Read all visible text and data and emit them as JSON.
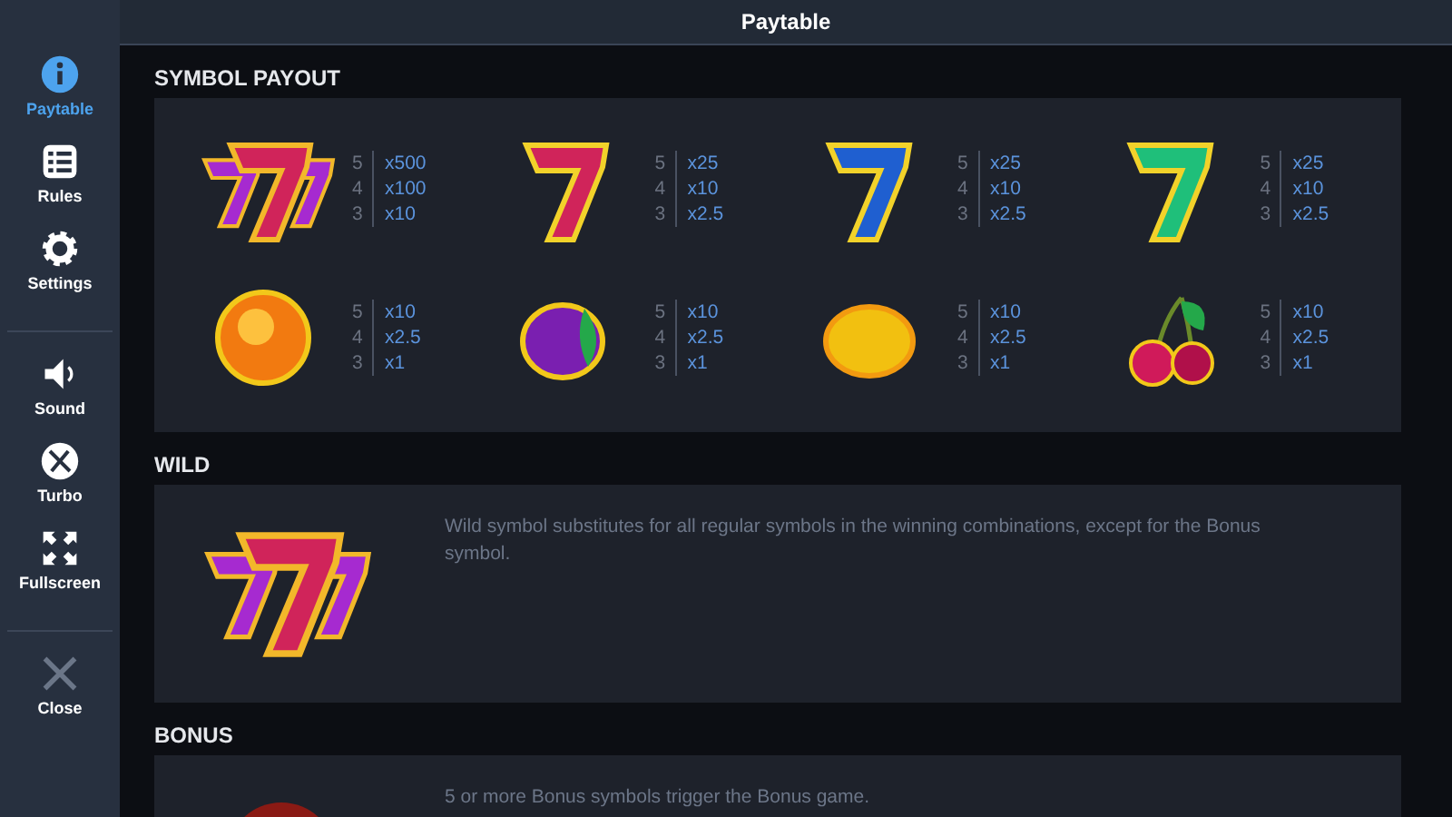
{
  "window": {
    "title": "Paytable"
  },
  "sidebar": {
    "groups": [
      [
        {
          "kind": "info",
          "label": "Paytable",
          "selected": true
        },
        {
          "kind": "list",
          "label": "Rules",
          "selected": false
        },
        {
          "kind": "gear",
          "label": "Settings",
          "selected": false
        }
      ],
      [
        {
          "kind": "sound",
          "label": "Sound",
          "selected": false
        },
        {
          "kind": "turbo",
          "label": "Turbo",
          "selected": false
        },
        {
          "kind": "fullscreen",
          "label": "Fullscreen",
          "selected": false
        }
      ],
      [
        {
          "kind": "close",
          "label": "Close",
          "selected": false
        }
      ]
    ]
  },
  "symbol_payout": {
    "title": "SYMBOL PAYOUT",
    "symbols": [
      {
        "kind": "triple-seven",
        "payouts": [
          {
            "count": "5",
            "value": "x500"
          },
          {
            "count": "4",
            "value": "x100"
          },
          {
            "count": "3",
            "value": "x10"
          }
        ]
      },
      {
        "kind": "seven",
        "color": "#d0245a",
        "payouts": [
          {
            "count": "5",
            "value": "x25"
          },
          {
            "count": "4",
            "value": "x10"
          },
          {
            "count": "3",
            "value": "x2.5"
          }
        ]
      },
      {
        "kind": "seven",
        "color": "#1f5fd0",
        "payouts": [
          {
            "count": "5",
            "value": "x25"
          },
          {
            "count": "4",
            "value": "x10"
          },
          {
            "count": "3",
            "value": "x2.5"
          }
        ]
      },
      {
        "kind": "seven",
        "color": "#1fbf7a",
        "payouts": [
          {
            "count": "5",
            "value": "x25"
          },
          {
            "count": "4",
            "value": "x10"
          },
          {
            "count": "3",
            "value": "x2.5"
          }
        ]
      },
      {
        "kind": "orange",
        "payouts": [
          {
            "count": "5",
            "value": "x10"
          },
          {
            "count": "4",
            "value": "x2.5"
          },
          {
            "count": "3",
            "value": "x1"
          }
        ]
      },
      {
        "kind": "plum",
        "payouts": [
          {
            "count": "5",
            "value": "x10"
          },
          {
            "count": "4",
            "value": "x2.5"
          },
          {
            "count": "3",
            "value": "x1"
          }
        ]
      },
      {
        "kind": "lemon",
        "payouts": [
          {
            "count": "5",
            "value": "x10"
          },
          {
            "count": "4",
            "value": "x2.5"
          },
          {
            "count": "3",
            "value": "x1"
          }
        ]
      },
      {
        "kind": "cherry",
        "payouts": [
          {
            "count": "5",
            "value": "x10"
          },
          {
            "count": "4",
            "value": "x2.5"
          },
          {
            "count": "3",
            "value": "x1"
          }
        ]
      }
    ]
  },
  "wild": {
    "title": "WILD",
    "text": "Wild symbol substitutes for all regular symbols in the winning combinations, except for the Bonus symbol."
  },
  "bonus": {
    "title": "BONUS",
    "text": "5 or more Bonus symbols trigger the Bonus game."
  }
}
